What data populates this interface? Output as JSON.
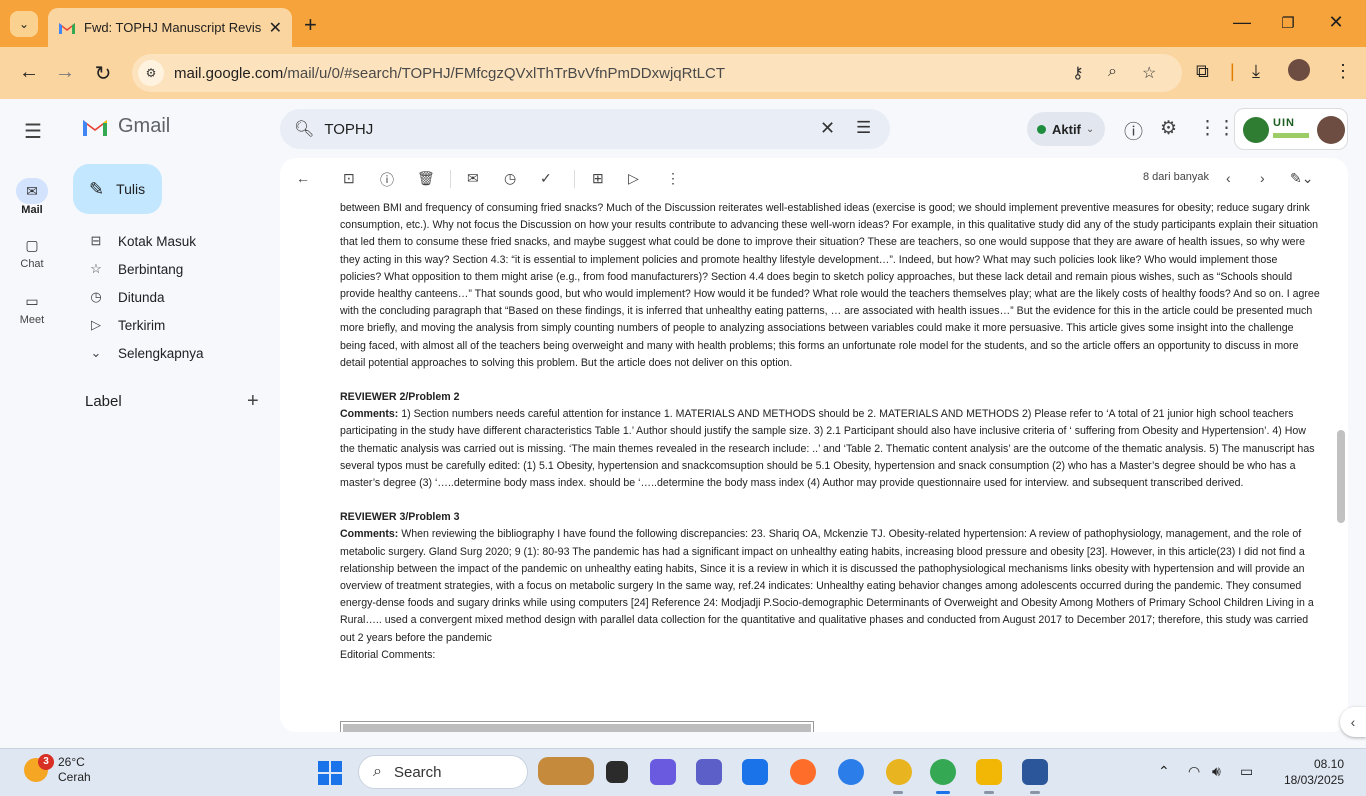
{
  "browser": {
    "tab_title": "Fwd: TOPHJ Manuscript Revision",
    "tab_close": "✕",
    "new_tab": "+",
    "url_host": "mail.google.com",
    "url_path": "/mail/u/0/#search/TOPHJ/FMfcgzQVxlThTrBvVfnPmDDxwjqRtLCT"
  },
  "gmail": {
    "app_name": "Gmail",
    "search_value": "TOPHJ",
    "status_label": "Aktif",
    "compose_label": "Tulis",
    "rail": [
      {
        "label": "Mail"
      },
      {
        "label": "Chat"
      },
      {
        "label": "Meet"
      }
    ],
    "sidebar": [
      {
        "label": "Kotak Masuk"
      },
      {
        "label": "Berbintang"
      },
      {
        "label": "Ditunda"
      },
      {
        "label": "Terkirim"
      },
      {
        "label": "Selengkapnya"
      }
    ],
    "label_heading": "Label",
    "label_add": "+",
    "org_badge": "UIN",
    "pager_text": "8 dari banyak"
  },
  "email": {
    "para1": "between BMI and frequency of consuming fried snacks? Much of the Discussion reiterates well-established ideas (exercise is good; we should implement preventive measures for obesity; reduce sugary drink consumption, etc.). Why not focus the Discussion on how your results contribute to advancing these well-worn ideas? For example, in this qualitative study did any of the study participants explain their situation that led them to consume these fried snacks, and maybe suggest what could be done to improve their situation? These are teachers, so one would suppose that they are aware of health issues, so why were they acting in this way? Section 4.3: “it is essential to implement policies and promote healthy lifestyle development…”. Indeed, but how? What may such policies look like? Who would implement those policies? What opposition to them might arise (e.g., from food manufacturers)? Section 4.4 does begin to sketch policy approaches, but these lack detail and remain pious wishes, such as “Schools should provide healthy canteens…” That sounds good, but who would implement? How would it be funded? What role would the teachers themselves play; what are the likely costs of healthy foods? And so on. I agree with the concluding paragraph that “Based on these findings, it is inferred that unhealthy eating patterns, … are associated with health issues…” But the evidence for this in the article could be presented much more briefly, and moving the analysis from simply counting numbers of people to analyzing associations between variables could make it more persuasive. This article gives some insight into the challenge being faced, with almost all of the teachers being overweight and many with health problems; this forms an unfortunate role model for the students, and so the article offers an opportunity to discuss in more detail potential approaches to solving this problem. But the article does not deliver on this option.",
    "reviewer2_heading": "REVIEWER 2/Problem 2",
    "comments_label": "Comments:",
    "reviewer2_text": " 1) Section numbers needs careful attention for instance 1. MATERIALS AND METHODS should be 2. MATERIALS AND METHODS 2) Please refer to ‘A total of 21 junior high school teachers participating in the study have different characteristics Table 1.’ Author should justify the sample size. 3) 2.1 Participant should also have inclusive criteria of ‘ suffering from Obesity and Hypertension’. 4) How the thematic analysis was carried out is missing. ‘The main themes revealed in the research include: ..’ and ‘Table 2. Thematic content analysis’ are the outcome of the thematic analysis. 5) The manuscript has several typos must be carefully edited: (1) 5.1 Obesity, hypertension and snackcomsuption should be 5.1 Obesity, hypertension and snack consumption (2) who has a Master’s degree should be who has a master’s degree (3) ‘…..determine body mass index. should be ‘…..determine the body mass index (4) Author may provide questionnaire used for interview. and subsequent transcribed derived.",
    "reviewer3_heading": "REVIEWER 3/Problem 3",
    "reviewer3_text": " When reviewing the bibliography I have found the following discrepancies: 23. Shariq OA, Mckenzie TJ. Obesity-related hypertension: A review of pathophysiology, management, and the role of metabolic surgery. Gland Surg 2020; 9 (1): 80-93 The pandemic has had a significant impact on unhealthy eating habits, increasing blood pressure and obesity [23]. However, in this article(23) I did not find a relationship between the impact of the pandemic on unhealthy eating habits, Since it is a review in which it is discussed the pathophysiological mechanisms links obesity with hypertension and will provide an overview of treatment strategies, with a focus on metabolic surgery In the same way, ref.24 indicates: Unhealthy eating behavior changes among adolescents occurred during the pandemic. They consumed energy-dense foods and sugary drinks while using computers [24] Reference 24: Modjadji P.Socio-demographic Determinants of Overweight and Obesity Among Mothers of Primary School Children Living in a Rural….. used a convergent mixed method design with parallel data collection for the quantitative and qualitative phases and conducted from August 2017 to December 2017; therefore, this study was carried out 2 years before the pandemic",
    "editorial_label": "Editorial Comments:"
  },
  "taskbar": {
    "notif_count": "3",
    "temp": "26°C",
    "weather": "Cerah",
    "search_label": "Search",
    "time": "08.10",
    "date": "18/03/2025"
  },
  "colors": {
    "chrome_frame": "#f5a33a",
    "compose_bg": "#c2e7ff",
    "status_green": "#1e8e3e"
  }
}
